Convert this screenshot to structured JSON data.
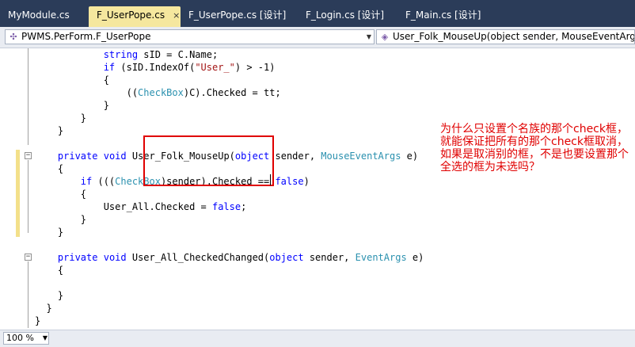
{
  "tabs": [
    {
      "label": "MyModule.cs"
    },
    {
      "label": "F_UserPope.cs",
      "close": "×"
    },
    {
      "label": "F_UserPope.cs [设计]"
    },
    {
      "label": "F_Login.cs [设计]"
    },
    {
      "label": "F_Main.cs [设计]"
    }
  ],
  "toolbar": {
    "class_combo": "PWMS.PerForm.F_UserPope",
    "member_combo": "User_Folk_MouseUp(object sender, MouseEventArgs"
  },
  "code_lines": [
    "            string sID = C.Name;",
    "            if (sID.IndexOf(\"User_\") > -1)",
    "            {",
    "                ((CheckBox)C).Checked = tt;",
    "            }",
    "        }",
    "    }",
    "",
    "    private void User_Folk_MouseUp(object sender, MouseEventArgs e)",
    "    {",
    "        if (((CheckBox)sender).Checked == false)",
    "        {",
    "            User_All.Checked = false;",
    "        }",
    "    }",
    "",
    "    private void User_All_CheckedChanged(object sender, EventArgs e)",
    "    {",
    "",
    "    }",
    "  }",
    "}"
  ],
  "annotation": "为什么只设置个名族的那个check框，就能保证把所有的那个check框取消，如果是取消别的框，不是也要设置那个全选的框为未选吗？",
  "status": {
    "zoom": "100 %"
  },
  "colors": {
    "keyword": "#0000ff",
    "type": "#2b91af",
    "string": "#a31515",
    "annotation": "#e00000",
    "tab_active": "#f5e79e",
    "tabbar": "#2b3c59"
  }
}
